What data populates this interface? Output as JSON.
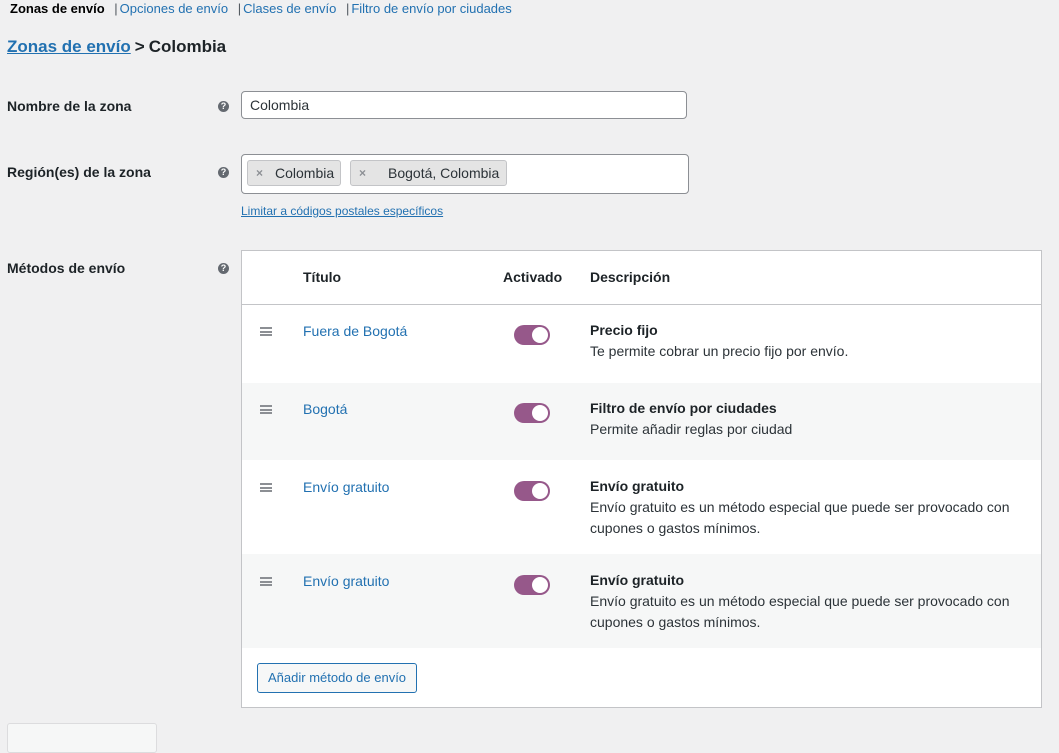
{
  "subnav": {
    "current": "Zonas de envío",
    "items": [
      "Opciones de envío",
      "Clases de envío",
      "Filtro de envío por ciudades"
    ],
    "separator": "|"
  },
  "breadcrumb": {
    "parent": "Zonas de envío",
    "separator": ">",
    "current": "Colombia"
  },
  "form": {
    "zone_name": {
      "label": "Nombre de la zona",
      "value": "Colombia"
    },
    "zone_regions": {
      "label": "Región(es) de la zona",
      "tags": [
        "Colombia",
        "Bogotá, Colombia"
      ],
      "remove_glyph": "×",
      "limit_link": "Limitar a códigos postales específicos"
    },
    "help_glyph": "?"
  },
  "methods": {
    "label": "Métodos de envío",
    "columns": {
      "title": "Título",
      "enabled": "Activado",
      "description": "Descripción"
    },
    "rows": [
      {
        "title": "Fuera de Bogotá",
        "enabled": true,
        "method_name": "Precio fijo",
        "description": "Te permite cobrar un precio fijo por envío."
      },
      {
        "title": "Bogotá",
        "enabled": true,
        "method_name": "Filtro de envío por ciudades",
        "description": "Permite añadir reglas por ciudad"
      },
      {
        "title": "Envío gratuito",
        "enabled": true,
        "method_name": "Envío gratuito",
        "description": "Envío gratuito es un método especial que puede ser provocado con cupones o gastos mínimos."
      },
      {
        "title": "Envío gratuito",
        "enabled": true,
        "method_name": "Envío gratuito",
        "description": "Envío gratuito es un método especial que puede ser provocado con cupones o gastos mínimos."
      }
    ],
    "add_button": "Añadir método de envío"
  },
  "colors": {
    "link": "#2271b1",
    "toggle_on": "#96588a",
    "background": "#f0f0f1"
  },
  "icons": {
    "help": "help-circle-icon",
    "drag": "drag-handle-icon",
    "remove": "remove-tag-icon"
  }
}
